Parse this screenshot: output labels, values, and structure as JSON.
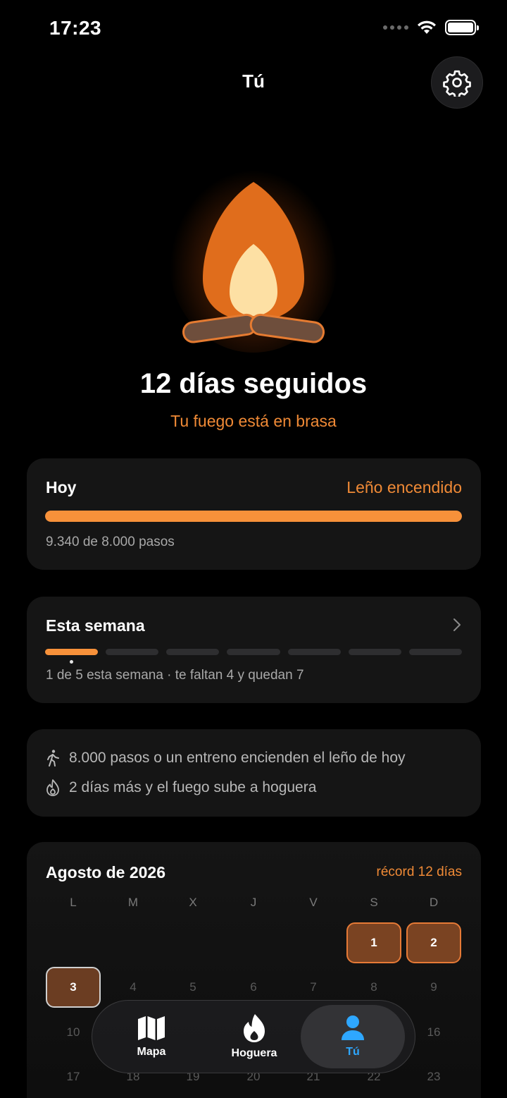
{
  "status_bar": {
    "time": "17:23"
  },
  "header": {
    "title": "Tú"
  },
  "streak": {
    "title": "12 días seguidos",
    "subtitle": "Tu fuego está en brasa"
  },
  "today": {
    "label": "Hoy",
    "status": "Leño encendido",
    "steps_text": "9.340 de 8.000 pasos",
    "progress": 1.0
  },
  "week": {
    "label": "Esta semana",
    "segments_total": 7,
    "segments_done": 1,
    "summary": "1 de 5 esta semana · te faltan 4 y quedan 7"
  },
  "tips": [
    {
      "icon": "walking-icon",
      "text": "8.000 pasos o un entreno encienden el leño de hoy"
    },
    {
      "icon": "flame-outline-icon",
      "text": "2 días más y el fuego sube a hoguera"
    }
  ],
  "calendar": {
    "month": "Agosto de 2026",
    "record": "récord 12 días",
    "weekdays": [
      "L",
      "M",
      "X",
      "J",
      "V",
      "S",
      "D"
    ],
    "days": {
      "d1": "1",
      "d2": "2",
      "d3": "3",
      "d4": "4",
      "d5": "5",
      "d6": "6",
      "d7": "7",
      "d8": "8",
      "d9": "9",
      "d10": "10",
      "d16": "16",
      "d17": "17",
      "d18": "18",
      "d19": "19",
      "d20": "20",
      "d21": "21",
      "d22": "22",
      "d23": "23"
    }
  },
  "tabbar": {
    "tabs": [
      {
        "label": "Mapa",
        "icon": "map-icon"
      },
      {
        "label": "Hoguera",
        "icon": "flame-icon"
      },
      {
        "label": "Tú",
        "icon": "person-icon",
        "selected": true
      }
    ]
  },
  "colors": {
    "accent": "#f7913a",
    "selected_tab": "#2ea7ff",
    "card": "#151515"
  }
}
